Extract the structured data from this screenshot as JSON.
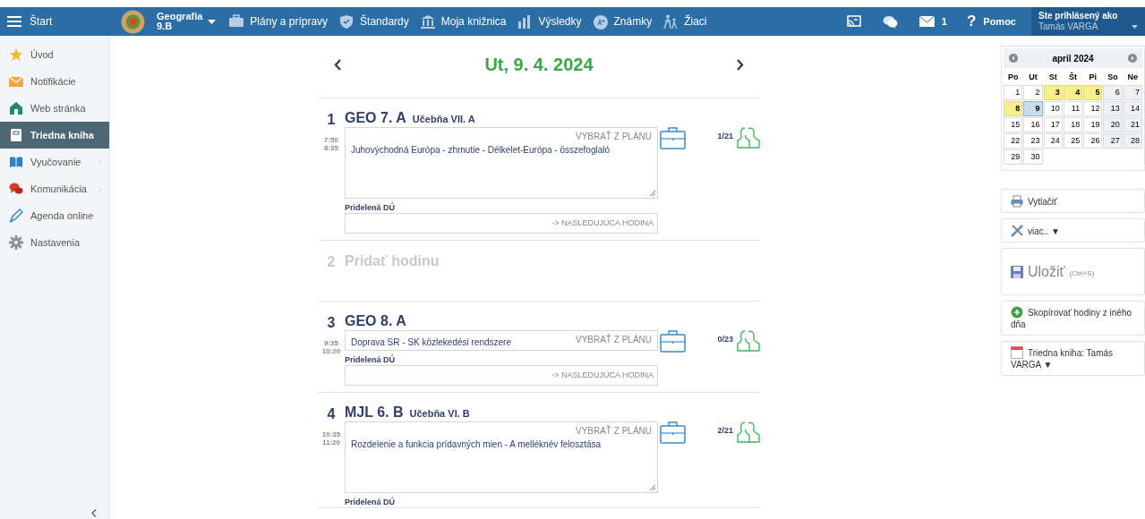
{
  "topbar": {
    "menu_label": "Štart",
    "class_subject": "Geografia",
    "class_name": "9.B",
    "nav": [
      {
        "kind": "plans",
        "label": "Plány a prípravy"
      },
      {
        "kind": "standards",
        "label": "Štandardy"
      },
      {
        "kind": "library",
        "label": "Moja knižnica"
      },
      {
        "kind": "results",
        "label": "Výsledky"
      },
      {
        "kind": "grades",
        "label": "Známky"
      },
      {
        "kind": "pupils",
        "label": "Žiaci"
      }
    ],
    "mail_count": "1",
    "help_mark": "?",
    "help_label": "Pomoc",
    "user_caption": "Ste prihlásený ako",
    "user_name": "Tamás VARGA"
  },
  "sidebar": {
    "items": [
      {
        "kind": "star",
        "label": "Úvod",
        "selected": false,
        "expandable": false
      },
      {
        "kind": "mail",
        "label": "Notifikácie",
        "selected": false,
        "expandable": false
      },
      {
        "kind": "home",
        "label": "Web stránka",
        "selected": false,
        "expandable": false
      },
      {
        "kind": "book",
        "label": "Triedna kniha",
        "selected": true,
        "expandable": false
      },
      {
        "kind": "open-book",
        "label": "Vyučovanie",
        "selected": false,
        "expandable": true
      },
      {
        "kind": "chat",
        "label": "Komunikácia",
        "selected": false,
        "expandable": true
      },
      {
        "kind": "pen",
        "label": "Agenda online",
        "selected": false,
        "expandable": false
      },
      {
        "kind": "gear",
        "label": "Nastavenia",
        "selected": false,
        "expandable": false
      }
    ]
  },
  "day": {
    "date": "Ut, 9. 4. 2024"
  },
  "lessons": [
    {
      "kind": "lesson",
      "number": "1",
      "title": "GEO 7. A",
      "room": "Učebňa VII. A",
      "start": "7:50",
      "end": "8:35",
      "plan_action": "VYBRAŤ Z PLÁNU",
      "topic": "Juhovýchodná Európa - zhrnutie - Délkelet-Európa - összefoglaló",
      "multiline": true,
      "homework_label": "Pridelená DÚ",
      "homework_action": "-> NASLEDUJÚCA HODINA",
      "attendance": "1/21"
    },
    {
      "kind": "empty",
      "number": "2",
      "title": "Pridať hodinu"
    },
    {
      "kind": "lesson",
      "number": "3",
      "title": "GEO 8. A",
      "start": "9:35",
      "end": "10:20",
      "plan_action": "VYBRAŤ Z PLÁNU",
      "topic": "Doprava SR - SK közlekedési rendszere",
      "multiline": false,
      "homework_label": "Pridelená DÚ",
      "homework_action": "-> NASLEDUJÚCA HODINA",
      "attendance": "0/23"
    },
    {
      "kind": "lesson",
      "number": "4",
      "title": "MJL 6. B",
      "room": "Učebňa VI. B",
      "start": "10:35",
      "end": "11:20",
      "plan_action": "VYBRAŤ Z PLÁNU",
      "topic": "Rozdelenie a funkcia prídavných mien - A melléknév felosztása",
      "multiline": true,
      "homework_label": "Pridelená DÚ",
      "attendance": "2/21"
    }
  ],
  "calendar": {
    "month": "april 2024",
    "weekdays": [
      "Po",
      "Ut",
      "St",
      "Št",
      "Pi",
      "So",
      "Ne"
    ],
    "days": [
      {
        "day": "1",
        "marked": false,
        "selected": false
      },
      {
        "day": "2",
        "marked": false,
        "selected": false
      },
      {
        "day": "3",
        "marked": true,
        "selected": false
      },
      {
        "day": "4",
        "marked": true,
        "selected": false
      },
      {
        "day": "5",
        "marked": true,
        "selected": false
      },
      {
        "day": "6",
        "marked": false,
        "selected": false
      },
      {
        "day": "7",
        "marked": false,
        "selected": false
      },
      {
        "day": "8",
        "marked": true,
        "selected": false
      },
      {
        "day": "9",
        "marked": false,
        "selected": true
      },
      {
        "day": "10",
        "marked": false,
        "selected": false
      },
      {
        "day": "11",
        "marked": false,
        "selected": false
      },
      {
        "day": "12",
        "marked": false,
        "selected": false
      },
      {
        "day": "13",
        "marked": false,
        "selected": false
      },
      {
        "day": "14",
        "marked": false,
        "selected": false
      },
      {
        "day": "15",
        "marked": false,
        "selected": false
      },
      {
        "day": "16",
        "marked": false,
        "selected": false
      },
      {
        "day": "17",
        "marked": false,
        "selected": false
      },
      {
        "day": "18",
        "marked": false,
        "selected": false
      },
      {
        "day": "19",
        "marked": false,
        "selected": false
      },
      {
        "day": "20",
        "marked": false,
        "selected": false
      },
      {
        "day": "21",
        "marked": false,
        "selected": false
      },
      {
        "day": "22",
        "marked": false,
        "selected": false
      },
      {
        "day": "23",
        "marked": false,
        "selected": false
      },
      {
        "day": "24",
        "marked": false,
        "selected": false
      },
      {
        "day": "25",
        "marked": false,
        "selected": false
      },
      {
        "day": "26",
        "marked": false,
        "selected": false
      },
      {
        "day": "27",
        "marked": false,
        "selected": false
      },
      {
        "day": "28",
        "marked": false,
        "selected": false
      },
      {
        "day": "29",
        "marked": false,
        "selected": false
      },
      {
        "day": "30",
        "marked": false,
        "selected": false
      }
    ]
  },
  "actions": [
    {
      "kind": "print",
      "label": "Vytlačiť"
    },
    {
      "kind": "more",
      "label": "viac.. ▼"
    },
    {
      "kind": "save",
      "label": "Uložiť",
      "hint": "(Ctrl+S)"
    },
    {
      "kind": "copy",
      "label": "Skopírovať hodiny z iného dňa"
    },
    {
      "kind": "classbook",
      "label": "Triedna kniha: Tamás VARGA ▼"
    }
  ]
}
